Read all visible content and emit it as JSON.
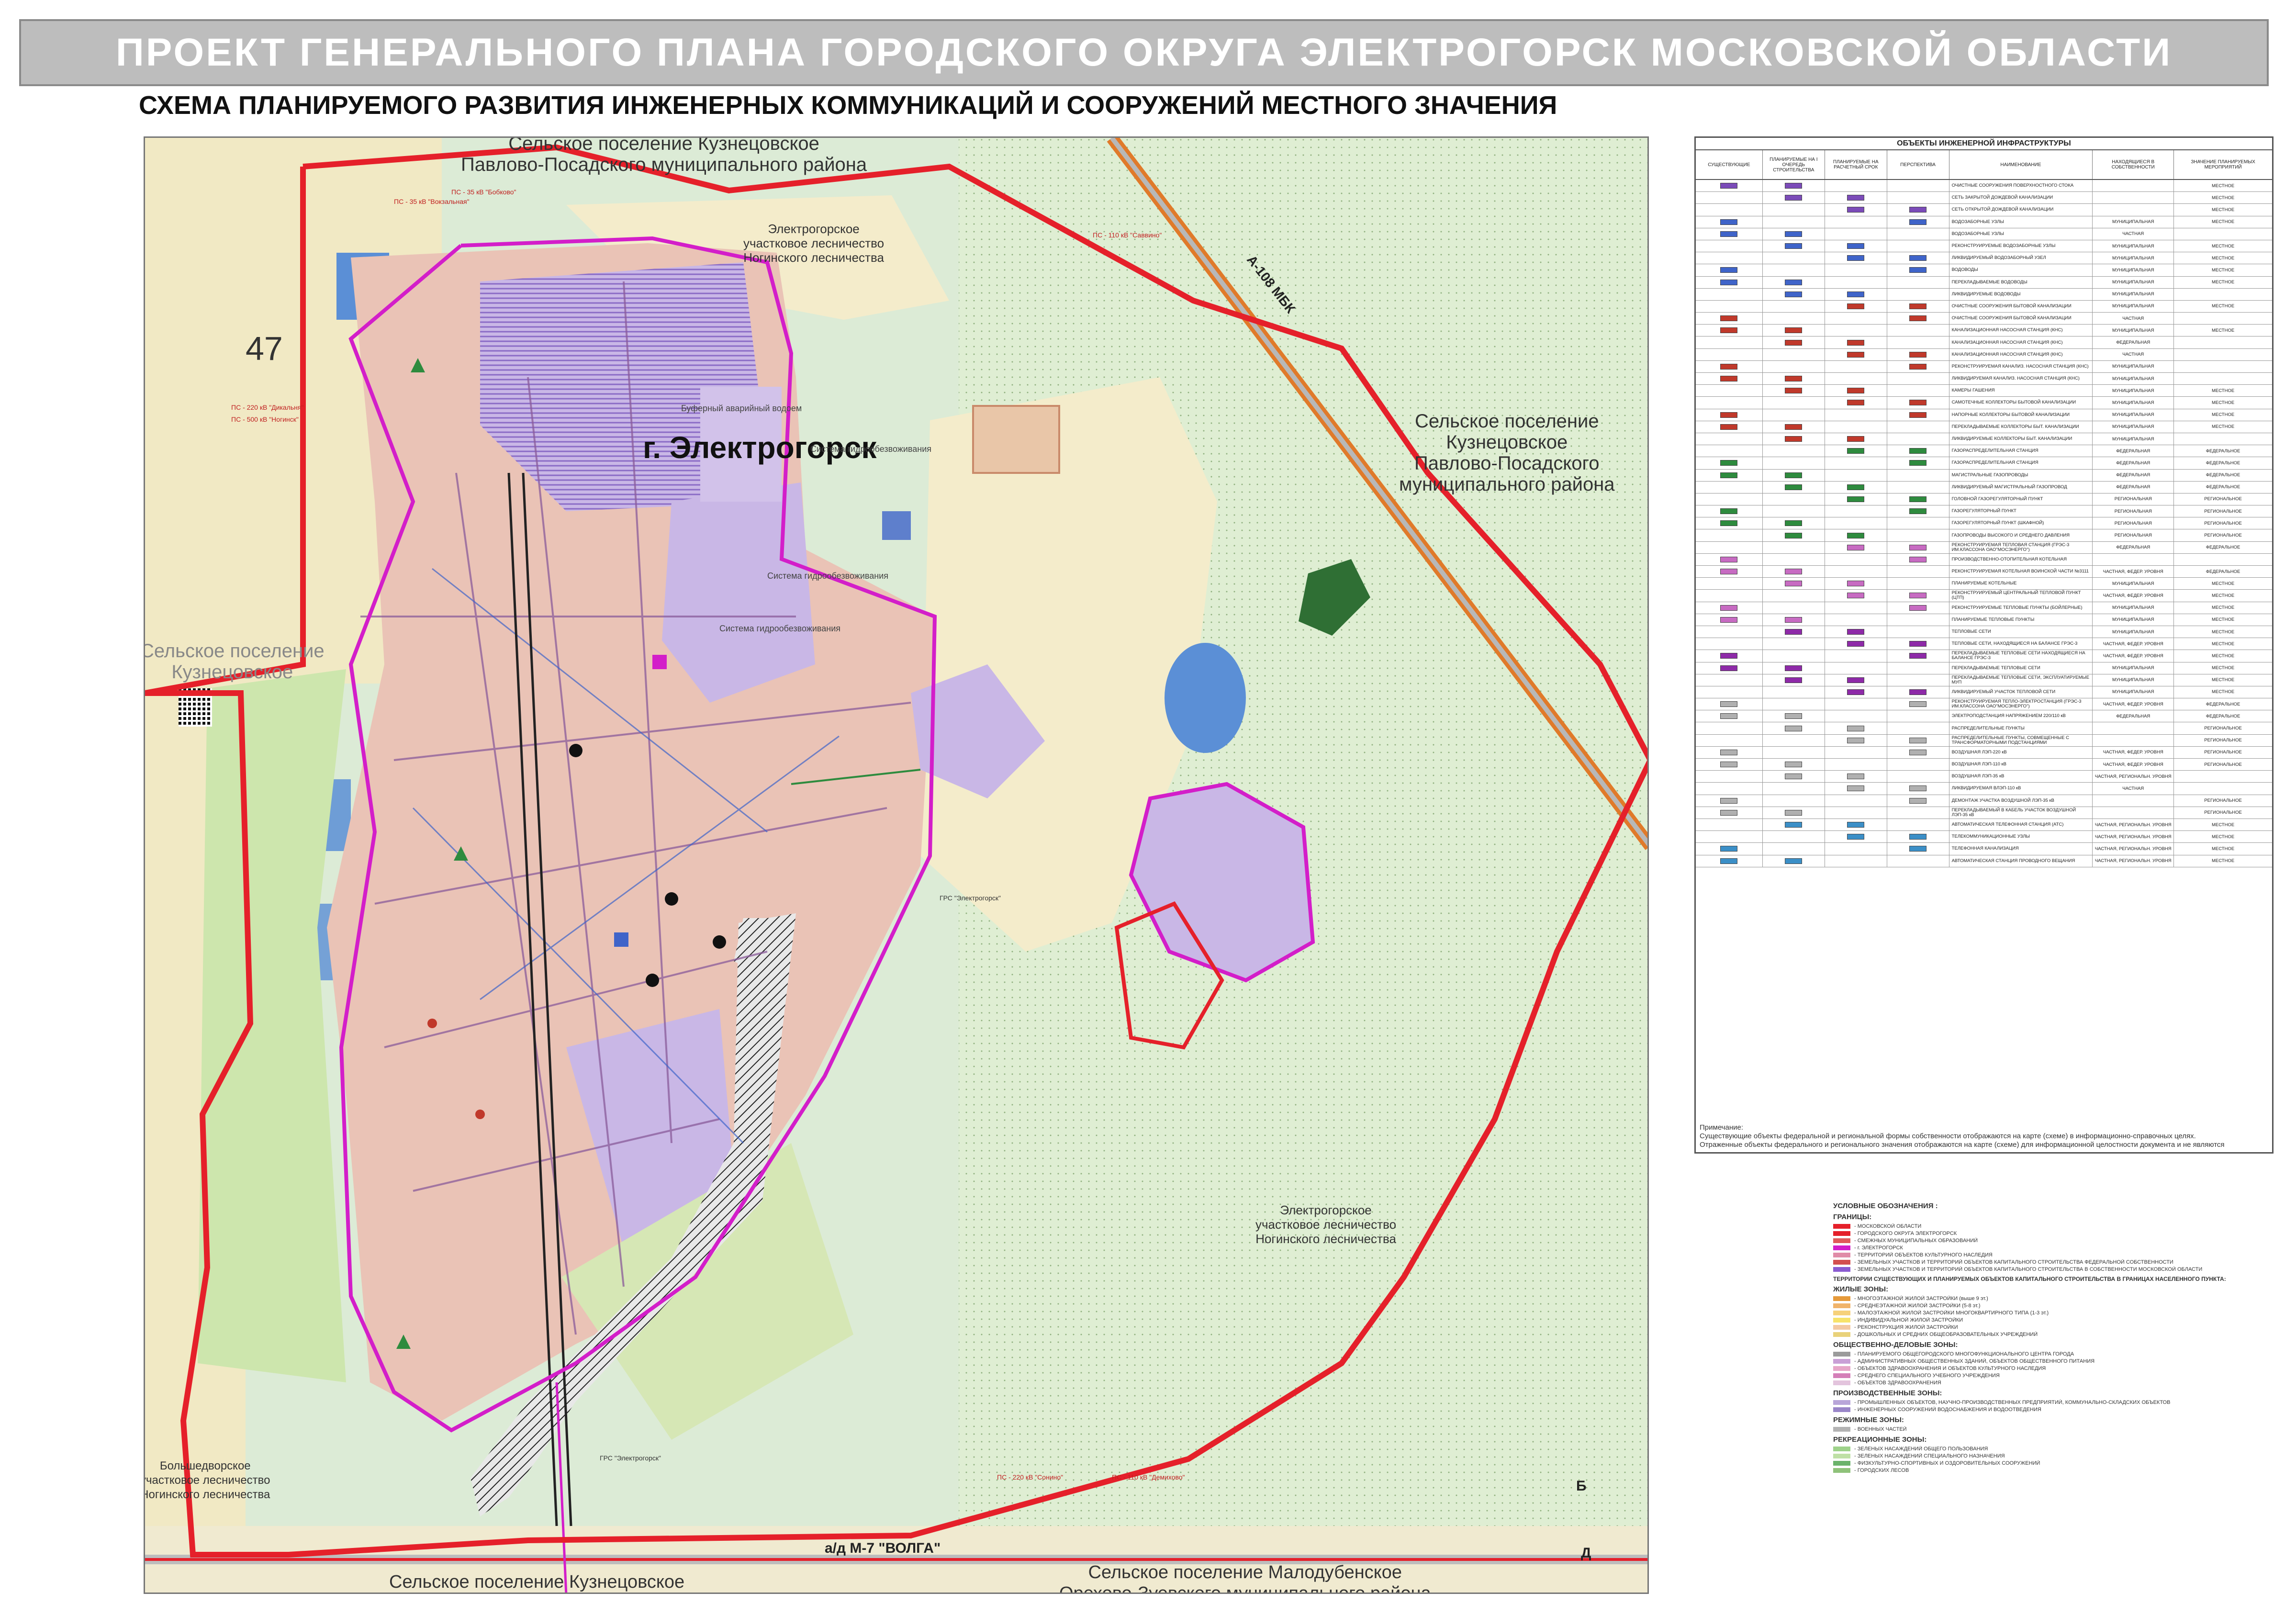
{
  "header": {
    "title": "ПРОЕКТ ГЕНЕРАЛЬНОГО ПЛАНА ГОРОДСКОГО ОКРУГА ЭЛЕКТРОГОРСК МОСКОВСКОЙ ОБЛАСТИ",
    "subtitle": "СХЕМА ПЛАНИРУЕМОГО РАЗВИТИЯ ИНЖЕНЕРНЫХ КОММУНИКАЦИЙ И СООРУЖЕНИЙ МЕСТНОГО ЗНАЧЕНИЯ"
  },
  "colors": {
    "boundary": "#e5202a",
    "city_boundary": "#d31ec9",
    "forest": "#cfe3c6",
    "field": "#f3ecc9",
    "residential": "#f2c2a8",
    "industrial": "#c9b7e6",
    "water": "#5b8fd6",
    "road": "#9a9a9a"
  },
  "map": {
    "labels": {
      "north_top": "Сельское поселение Кузнецовское",
      "north_top2": "Павлово-Посадского муниципального района",
      "forest_north_1": "Электрогорское",
      "forest_north_2": "участковое лесничество",
      "forest_north_3": "Ногинского лесничества",
      "city": "г. Электрогорск",
      "east_1": "Сельское поселение",
      "east_2": "Кузнецовское",
      "east_3": "Павлово-Посадского",
      "east_4": "муниципального района",
      "west_1": "Сельское поселение",
      "west_2": "Кузнецовское",
      "forest_se_1": "Электрогорское",
      "forest_se_2": "участковое лесничество",
      "forest_se_3": "Ногинского лесничества",
      "forest_sw_1": "Большедворское",
      "forest_sw_2": "участковое лесничество",
      "forest_sw_3": "Ногинского лесничества",
      "south_left": "Сельское поселение Кузнецовское",
      "south_right_1": "Сельское поселение Малодубенское",
      "south_right_2": "Орехово-Зуевского муниципального района",
      "road_m7": "а/д М-7 \"ВОЛГА\"",
      "road_a108": "А-108 МБК",
      "quarter": "47",
      "water_reservoir": "Буферный аварийный водоем",
      "sys1": "Система гидрообезвоживания",
      "sys2": "Система гидрообезвоживания",
      "sys3": "Система гидрообезвоживания",
      "ps_35": "ПС - 35 кВ \"Вокзальная\"",
      "ps_35b": "ПС - 35 кВ \"Бобково\"",
      "ps_110": "ПС - 110 кВ \"Саввино\"",
      "ps_220": "ПС - 220 кВ \"Дикальня\"",
      "ps_220b": "ПС - 500 кВ \"Ногинск\"",
      "grs": "ГРС \"Электрогорск\"",
      "grs2": "ГРС \"Электрогорск\"",
      "ps_220_south": "ПС - 220 кВ \"Сонино\"",
      "ps_110_south": "ПС - 110 кВ \"Демихово\"",
      "mark_b": "Б",
      "mark_d": "Д"
    }
  },
  "legend": {
    "title": "ОБЪЕКТЫ ИНЖЕНЕРНОЙ ИНФРАСТРУКТУРЫ",
    "columns": [
      "СУЩЕСТВУЮЩИЕ",
      "ПЛАНИРУЕМЫЕ НА I ОЧЕРЕДЬ СТРОИТЕЛЬСТВА",
      "ПЛАНИРУЕМЫЕ НА РАСЧЕТНЫЙ СРОК",
      "ПЕРСПЕКТИВА",
      "НАИМЕНОВАНИЕ",
      "НАХОДЯЩИЕСЯ В СОБСТВЕННОСТИ",
      "ЗНАЧЕНИЕ ПЛАНИРУЕМЫХ МЕРОПРИЯТИЙ"
    ],
    "rows": [
      {
        "name": "ОЧИСТНЫЕ СООРУЖЕНИЯ ПОВЕРХНОСТНОГО СТОКА",
        "own": "",
        "sig": "МЕСТНОЕ",
        "color": "#7b4bb8"
      },
      {
        "name": "СЕТЬ ЗАКРЫТОЙ ДОЖДЕВОЙ КАНАЛИЗАЦИИ",
        "own": "",
        "sig": "МЕСТНОЕ",
        "color": "#7b4bb8"
      },
      {
        "name": "СЕТЬ ОТКРЫТОЙ ДОЖДЕВОЙ КАНАЛИЗАЦИИ",
        "own": "",
        "sig": "МЕСТНОЕ",
        "color": "#7b4bb8"
      },
      {
        "name": "ВОДОЗАБОРНЫЕ УЗЛЫ",
        "own": "МУНИЦИПАЛЬНАЯ",
        "sig": "МЕСТНОЕ",
        "color": "#3f64c9"
      },
      {
        "name": "ВОДОЗАБОРНЫЕ УЗЛЫ",
        "own": "ЧАСТНАЯ",
        "sig": "",
        "color": "#3f64c9"
      },
      {
        "name": "РЕКОНСТРУИРУЕМЫЕ ВОДОЗАБОРНЫЕ УЗЛЫ",
        "own": "МУНИЦИПАЛЬНАЯ",
        "sig": "МЕСТНОЕ",
        "color": "#3f64c9"
      },
      {
        "name": "ЛИКВИДИРУЕМЫЙ ВОДОЗАБОРНЫЙ УЗЕЛ",
        "own": "МУНИЦИПАЛЬНАЯ",
        "sig": "МЕСТНОЕ",
        "color": "#3f64c9"
      },
      {
        "name": "ВОДОВОДЫ",
        "own": "МУНИЦИПАЛЬНАЯ",
        "sig": "МЕСТНОЕ",
        "color": "#3f64c9"
      },
      {
        "name": "ПЕРЕКЛАДЫВАЕМЫЕ ВОДОВОДЫ",
        "own": "МУНИЦИПАЛЬНАЯ",
        "sig": "МЕСТНОЕ",
        "color": "#3f64c9"
      },
      {
        "name": "ЛИКВИДИРУЕМЫЕ ВОДОВОДЫ",
        "own": "МУНИЦИПАЛЬНАЯ",
        "sig": "",
        "color": "#3f64c9"
      },
      {
        "name": "ОЧИСТНЫЕ СООРУЖЕНИЯ БЫТОВОЙ КАНАЛИЗАЦИИ",
        "own": "МУНИЦИПАЛЬНАЯ",
        "sig": "МЕСТНОЕ",
        "color": "#c0392b"
      },
      {
        "name": "ОЧИСТНЫЕ СООРУЖЕНИЯ БЫТОВОЙ КАНАЛИЗАЦИИ",
        "own": "ЧАСТНАЯ",
        "sig": "",
        "color": "#c0392b"
      },
      {
        "name": "КАНАЛИЗАЦИОННАЯ НАСОСНАЯ СТАНЦИЯ (КНС)",
        "own": "МУНИЦИПАЛЬНАЯ",
        "sig": "МЕСТНОЕ",
        "color": "#c0392b"
      },
      {
        "name": "КАНАЛИЗАЦИОННАЯ НАСОСНАЯ СТАНЦИЯ (КНС)",
        "own": "ФЕДЕРАЛЬНАЯ",
        "sig": "",
        "color": "#c0392b"
      },
      {
        "name": "КАНАЛИЗАЦИОННАЯ НАСОСНАЯ СТАНЦИЯ (КНС)",
        "own": "ЧАСТНАЯ",
        "sig": "",
        "color": "#c0392b"
      },
      {
        "name": "РЕКОНСТРУИРУЕМАЯ КАНАЛИЗ. НАСОСНАЯ СТАНЦИЯ (КНС)",
        "own": "МУНИЦИПАЛЬНАЯ",
        "sig": "",
        "color": "#c0392b"
      },
      {
        "name": "ЛИКВИДИРУЕМАЯ КАНАЛИЗ. НАСОСНАЯ СТАНЦИЯ (КНС)",
        "own": "МУНИЦИПАЛЬНАЯ",
        "sig": "",
        "color": "#c0392b"
      },
      {
        "name": "КАМЕРЫ ГАШЕНИЯ",
        "own": "МУНИЦИПАЛЬНАЯ",
        "sig": "МЕСТНОЕ",
        "color": "#c0392b"
      },
      {
        "name": "САМОТЕЧНЫЕ КОЛЛЕКТОРЫ БЫТОВОЙ КАНАЛИЗАЦИИ",
        "own": "МУНИЦИПАЛЬНАЯ",
        "sig": "МЕСТНОЕ",
        "color": "#c0392b"
      },
      {
        "name": "НАПОРНЫЕ КОЛЛЕКТОРЫ БЫТОВОЙ КАНАЛИЗАЦИИ",
        "own": "МУНИЦИПАЛЬНАЯ",
        "sig": "МЕСТНОЕ",
        "color": "#c0392b"
      },
      {
        "name": "ПЕРЕКЛАДЫВАЕМЫЕ КОЛЛЕКТОРЫ БЫТ. КАНАЛИЗАЦИИ",
        "own": "МУНИЦИПАЛЬНАЯ",
        "sig": "МЕСТНОЕ",
        "color": "#c0392b"
      },
      {
        "name": "ЛИКВИДИРУЕМЫЕ КОЛЛЕКТОРЫ БЫТ. КАНАЛИЗАЦИИ",
        "own": "МУНИЦИПАЛЬНАЯ",
        "sig": "",
        "color": "#c0392b"
      },
      {
        "name": "ГАЗОРАСПРЕДЕЛИТЕЛЬНАЯ СТАНЦИЯ",
        "own": "ФЕДЕРАЛЬНАЯ",
        "sig": "ФЕДЕРАЛЬНОЕ",
        "color": "#2e8b3e"
      },
      {
        "name": "ГАЗОРАСПРЕДЕЛИТЕЛЬНАЯ СТАНЦИЯ",
        "own": "ФЕДЕРАЛЬНАЯ",
        "sig": "ФЕДЕРАЛЬНОЕ",
        "color": "#2e8b3e"
      },
      {
        "name": "МАГИСТРАЛЬНЫЕ ГАЗОПРОВОДЫ",
        "own": "ФЕДЕРАЛЬНАЯ",
        "sig": "ФЕДЕРАЛЬНОЕ",
        "color": "#2e8b3e"
      },
      {
        "name": "ЛИКВИДИРУЕМЫЙ МАГИСТРАЛЬНЫЙ ГАЗОПРОВОД",
        "own": "ФЕДЕРАЛЬНАЯ",
        "sig": "ФЕДЕРАЛЬНОЕ",
        "color": "#2e8b3e"
      },
      {
        "name": "ГОЛОВНОЙ ГАЗОРЕГУЛЯТОРНЫЙ ПУНКТ",
        "own": "РЕГИОНАЛЬНАЯ",
        "sig": "РЕГИОНАЛЬНОЕ",
        "color": "#2e8b3e"
      },
      {
        "name": "ГАЗОРЕГУЛЯТОРНЫЙ ПУНКТ",
        "own": "РЕГИОНАЛЬНАЯ",
        "sig": "РЕГИОНАЛЬНОЕ",
        "color": "#2e8b3e"
      },
      {
        "name": "ГАЗОРЕГУЛЯТОРНЫЙ ПУНКТ (ШКАФНОЙ)",
        "own": "РЕГИОНАЛЬНАЯ",
        "sig": "РЕГИОНАЛЬНОЕ",
        "color": "#2e8b3e"
      },
      {
        "name": "ГАЗОПРОВОДЫ ВЫСОКОГО И СРЕДНЕГО ДАВЛЕНИЯ",
        "own": "РЕГИОНАЛЬНАЯ",
        "sig": "РЕГИОНАЛЬНОЕ",
        "color": "#2e8b3e"
      },
      {
        "name": "РЕКОНСТРУИРУЕМАЯ ТЕПЛОВАЯ СТАНЦИЯ (ГРЭС-3 ИМ.КЛАССОНА ОАО\"МОСЭНЕРГО\")",
        "own": "ФЕДЕРАЛЬНАЯ",
        "sig": "ФЕДЕРАЛЬНОЕ",
        "color": "#c76bc2"
      },
      {
        "name": "ПРОИЗВОДСТВЕННО-ОТОПИТЕЛЬНАЯ КОТЕЛЬНАЯ",
        "own": "",
        "sig": "",
        "color": "#c76bc2"
      },
      {
        "name": "РЕКОНСТРУИРУЕМАЯ КОТЕЛЬНАЯ ВОИНСКОЙ ЧАСТИ №3111",
        "own": "ЧАСТНАЯ, ФЕДЕР. УРОВНЯ",
        "sig": "ФЕДЕРАЛЬНОЕ",
        "color": "#c76bc2"
      },
      {
        "name": "ПЛАНИРУЕМЫЕ КОТЕЛЬНЫЕ",
        "own": "МУНИЦИПАЛЬНАЯ",
        "sig": "МЕСТНОЕ",
        "color": "#c76bc2"
      },
      {
        "name": "РЕКОНСТРУИРУЕМЫЙ ЦЕНТРАЛЬНЫЙ ТЕПЛОВОЙ ПУНКТ (ЦТП)",
        "own": "ЧАСТНАЯ, ФЕДЕР. УРОВНЯ",
        "sig": "МЕСТНОЕ",
        "color": "#c76bc2"
      },
      {
        "name": "РЕКОНСТРУИРУЕМЫЕ ТЕПЛОВЫЕ ПУНКТЫ (БОЙЛЕРНЫЕ)",
        "own": "МУНИЦИПАЛЬНАЯ",
        "sig": "МЕСТНОЕ",
        "color": "#c76bc2"
      },
      {
        "name": "ПЛАНИРУЕМЫЕ ТЕПЛОВЫЕ ПУНКТЫ",
        "own": "МУНИЦИПАЛЬНАЯ",
        "sig": "МЕСТНОЕ",
        "color": "#c76bc2"
      },
      {
        "name": "ТЕПЛОВЫЕ СЕТИ",
        "own": "МУНИЦИПАЛЬНАЯ",
        "sig": "МЕСТНОЕ",
        "color": "#8e2aa8"
      },
      {
        "name": "ТЕПЛОВЫЕ СЕТИ, НАХОДЯЩИЕСЯ НА БАЛАНСЕ ГРЭС-3",
        "own": "ЧАСТНАЯ, ФЕДЕР. УРОВНЯ",
        "sig": "МЕСТНОЕ",
        "color": "#8e2aa8"
      },
      {
        "name": "ПЕРЕКЛАДЫВАЕМЫЕ ТЕПЛОВЫЕ СЕТИ НАХОДЯЩИЕСЯ НА БАЛАНСЕ ГРЭС-3",
        "own": "ЧАСТНАЯ, ФЕДЕР. УРОВНЯ",
        "sig": "МЕСТНОЕ",
        "color": "#8e2aa8"
      },
      {
        "name": "ПЕРЕКЛАДЫВАЕМЫЕ ТЕПЛОВЫЕ СЕТИ",
        "own": "МУНИЦИПАЛЬНАЯ",
        "sig": "МЕСТНОЕ",
        "color": "#8e2aa8"
      },
      {
        "name": "ПЕРЕКЛАДЫВАЕМЫЕ ТЕПЛОВЫЕ СЕТИ, ЭКСПЛУАТИРУЕМЫЕ МУП",
        "own": "МУНИЦИПАЛЬНАЯ",
        "sig": "МЕСТНОЕ",
        "color": "#8e2aa8"
      },
      {
        "name": "ЛИКВИДИРУЕМЫЙ УЧАСТОК ТЕПЛОВОЙ СЕТИ",
        "own": "МУНИЦИПАЛЬНАЯ",
        "sig": "МЕСТНОЕ",
        "color": "#8e2aa8"
      },
      {
        "name": "РЕКОНСТРУИРУЕМАЯ ТЕПЛО-ЭЛЕКТРОСТАНЦИЯ (ГРЭС-3 ИМ.КЛАССОНА ОАО\"МОСЭНЕРГО\")",
        "own": "ЧАСТНАЯ, ФЕДЕР. УРОВНЯ",
        "sig": "ФЕДЕРАЛЬНОЕ",
        "color": "#b0b0b0"
      },
      {
        "name": "ЭЛЕКТРОПОДСТАНЦИЯ НАПРЯЖЕНИЕМ 220/110 кВ",
        "own": "ФЕДЕРАЛЬНАЯ",
        "sig": "ФЕДЕРАЛЬНОЕ",
        "color": "#b0b0b0"
      },
      {
        "name": "РАСПРЕДЕЛИТЕЛЬНЫЕ ПУНКТЫ",
        "own": "",
        "sig": "РЕГИОНАЛЬНОЕ",
        "color": "#b0b0b0"
      },
      {
        "name": "РАСПРЕДЕЛИТЕЛЬНЫЕ ПУНКТЫ, СОВМЕЩЕННЫЕ С ТРАНСФОРМАТОРНЫМИ ПОДСТАНЦИЯМИ",
        "own": "",
        "sig": "РЕГИОНАЛЬНОЕ",
        "color": "#b0b0b0"
      },
      {
        "name": "ВОЗДУШНАЯ ЛЭП-220 кВ",
        "own": "ЧАСТНАЯ, ФЕДЕР. УРОВНЯ",
        "sig": "РЕГИОНАЛЬНОЕ",
        "color": "#b0b0b0"
      },
      {
        "name": "ВОЗДУШНАЯ ЛЭП-110 кВ",
        "own": "ЧАСТНАЯ, ФЕДЕР. УРОВНЯ",
        "sig": "РЕГИОНАЛЬНОЕ",
        "color": "#b0b0b0"
      },
      {
        "name": "ВОЗДУШНАЯ ЛЭП-35 кВ",
        "own": "ЧАСТНАЯ, РЕГИОНАЛЬН. УРОВНЯ",
        "sig": "",
        "color": "#b0b0b0"
      },
      {
        "name": "ЛИКВИДИРУЕМАЯ ВЛЭП-110 кВ",
        "own": "ЧАСТНАЯ",
        "sig": "",
        "color": "#b0b0b0"
      },
      {
        "name": "ДЕМОНТАЖ УЧАСТКА ВОЗДУШНОЙ ЛЭП-35 кВ",
        "own": "",
        "sig": "РЕГИОНАЛЬНОЕ",
        "color": "#b0b0b0"
      },
      {
        "name": "ПЕРЕКЛАДЫВАЕМЫЙ В КАБЕЛЬ УЧАСТОК ВОЗДУШНОЙ ЛЭП-35 кВ",
        "own": "",
        "sig": "РЕГИОНАЛЬНОЕ",
        "color": "#b0b0b0"
      },
      {
        "name": "АВТОМАТИЧЕСКАЯ ТЕЛЕФОННАЯ СТАНЦИЯ (АТС)",
        "own": "ЧАСТНАЯ, РЕГИОНАЛЬН. УРОВНЯ",
        "sig": "МЕСТНОЕ",
        "color": "#3b8fc7"
      },
      {
        "name": "ТЕЛЕКОММУНИКАЦИОННЫЕ УЗЛЫ",
        "own": "ЧАСТНАЯ, РЕГИОНАЛЬН. УРОВНЯ",
        "sig": "МЕСТНОЕ",
        "color": "#3b8fc7"
      },
      {
        "name": "ТЕЛЕФОННАЯ КАНАЛИЗАЦИЯ",
        "own": "ЧАСТНАЯ, РЕГИОНАЛЬН. УРОВНЯ",
        "sig": "МЕСТНОЕ",
        "color": "#3b8fc7"
      },
      {
        "name": "АВТОМАТИЧЕСКАЯ СТАНЦИЯ ПРОВОДНОГО ВЕЩАНИЯ",
        "own": "ЧАСТНАЯ, РЕГИОНАЛЬН. УРОВНЯ",
        "sig": "МЕСТНОЕ",
        "color": "#3b8fc7"
      }
    ],
    "note_title": "Примечание:",
    "note_1": "Существующие объекты федеральной и региональной формы собственности отображаются на карте (схеме) в информационно-справочных целях.",
    "note_2": "Отраженные объекты федерального и регионального значения отображаются на карте (схеме) для информационной целостности документа и не являются"
  },
  "conventions": {
    "title": "УСЛОВНЫЕ ОБОЗНАЧЕНИЯ :",
    "group_borders": "ГРАНИЦЫ:",
    "borders": [
      {
        "text": "- МОСКОВСКОЙ ОБЛАСТИ",
        "color": "#e5202a"
      },
      {
        "text": "- ГОРОДСКОГО ОКРУГА ЭЛЕКТРОГОРСК",
        "color": "#e5202a"
      },
      {
        "text": "- СМЕЖНЫХ МУНИЦИПАЛЬНЫХ ОБРАЗОВАНИЙ",
        "color": "#e05a5a"
      },
      {
        "text": "- г. ЭЛЕКТРОГОРСК",
        "color": "#d31ec9"
      },
      {
        "text": "- ТЕРРИТОРИЙ ОБЪЕКТОВ КУЛЬТУРНОГО НАСЛЕДИЯ",
        "color": "#e08ca8"
      },
      {
        "text": "- ЗЕМЕЛЬНЫХ УЧАСТКОВ И ТЕРРИТОРИЙ ОБЪЕКТОВ КАПИТАЛЬНОГО СТРОИТЕЛЬСТВА ФЕДЕРАЛЬНОЙ СОБСТВЕННОСТИ",
        "color": "#d34f4f"
      },
      {
        "text": "- ЗЕМЕЛЬНЫХ УЧАСТКОВ И ТЕРРИТОРИЙ ОБЪЕКТОВ КАПИТАЛЬНОГО СТРОИТЕЛЬСТВА В СОБСТВЕННОСТИ МОСКОВСКОЙ ОБЛАСТИ",
        "color": "#8a5bd1"
      }
    ],
    "group_territories": "ТЕРРИТОРИИ СУЩЕСТВУЮЩИХ И ПЛАНИРУЕМЫХ ОБЪЕКТОВ КАПИТАЛЬНОГО СТРОИТЕЛЬСТВА В ГРАНИЦАХ НАСЕЛЕННОГО ПУНКТА:",
    "group_living": "ЖИЛЫЕ ЗОНЫ:",
    "living": [
      {
        "text": "- МНОГОЭТАЖНОЙ ЖИЛОЙ ЗАСТРОЙКИ (выше 9 эт.)",
        "color": "#e69a3a"
      },
      {
        "text": "- СРЕДНЕЭТАЖНОЙ ЖИЛОЙ ЗАСТРОЙКИ (5-8 эт.)",
        "color": "#f0b36a"
      },
      {
        "text": "- МАЛОЭТАЖНОЙ ЖИЛОЙ ЗАСТРОЙКИ МНОГОКВАРТИРНОГО ТИПА (1-3 эт.)",
        "color": "#f6d17a"
      },
      {
        "text": "- ИНДИВИДУАЛЬНОЙ ЖИЛОЙ ЗАСТРОЙКИ",
        "color": "#f7e36a"
      },
      {
        "text": "- РЕКОНСТРУКЦИЯ ЖИЛОЙ ЗАСТРОЙКИ",
        "color": "#f3c9a2"
      },
      {
        "text": "- ДОШКОЛЬНЫХ И СРЕДНИХ ОБЩЕОБРАЗОВАТЕЛЬНЫХ УЧРЕЖДЕНИЙ",
        "color": "#e9d27a"
      }
    ],
    "group_public": "ОБЩЕСТВЕННО-ДЕЛОВЫЕ ЗОНЫ:",
    "public": [
      {
        "text": "- ПЛАНИРУЕМОГО ОБЩЕГОРОДСКОГО МНОГОФУНКЦИОНАЛЬНОГО ЦЕНТРА ГОРОДА",
        "color": "#9b9b9b"
      },
      {
        "text": "- АДМИНИСТРАТИВНЫХ ОБЩЕСТВЕННЫХ ЗДАНИЙ, ОБЪЕКТОВ ОБЩЕСТВЕННОГО ПИТАНИЯ",
        "color": "#c9a0d6"
      },
      {
        "text": "- ОБЪЕКТОВ ЗДРАВООХРАНЕНИЯ И ОБЪЕКТОВ КУЛЬТУРНОГО НАСЛЕДИЯ",
        "color": "#e7a6c8"
      },
      {
        "text": "- СРЕДНЕГО СПЕЦИАЛЬНОГО УЧЕБНОГО УЧРЕЖДЕНИЯ",
        "color": "#d47fb8"
      },
      {
        "text": "- ОБЪЕКТОВ ЗДРАВООХРАНЕНИЯ",
        "color": "#e3c4dd"
      }
    ],
    "group_industrial": "ПРОИЗВОДСТВЕННЫЕ ЗОНЫ:",
    "industrial": [
      {
        "text": "- ПРОМЫШЛЕННЫХ ОБЪЕКТОВ, НАУЧНО-ПРОИЗВОДСТВЕННЫХ ПРЕДПРИЯТИЙ, КОММУНАЛЬНО-СКЛАДСКИХ ОБЪЕКТОВ",
        "color": "#b9a6d9"
      },
      {
        "text": "- ИНЖЕНЕРНЫХ СООРУЖЕНИЙ ВОДОСНАБЖЕНИЯ И ВОДООТВЕДЕНИЯ",
        "color": "#9a86c9"
      }
    ],
    "group_military": "РЕЖИМНЫЕ ЗОНЫ:",
    "military": [
      {
        "text": "- ВОЕННЫХ ЧАСТЕЙ",
        "color": "#b3b3b3"
      }
    ],
    "group_recreation": "РЕКРЕАЦИОННЫЕ ЗОНЫ:",
    "recreation": [
      {
        "text": "- ЗЕЛЕНЫХ НАСАЖДЕНИЙ ОБЩЕГО ПОЛЬЗОВАНИЯ",
        "color": "#9ed28a"
      },
      {
        "text": "- ЗЕЛЕНЫХ НАСАЖДЕНИЙ СПЕЦИАЛЬНОГО НАЗНАЧЕНИЯ",
        "color": "#bfe0a6"
      },
      {
        "text": "- ФИЗКУЛЬТУРНО-СПОРТИВНЫХ И ОЗДОРОВИТЕЛЬНЫХ СООРУЖЕНИЙ",
        "color": "#6bb36b"
      },
      {
        "text": "- ГОРОДСКИХ ЛЕСОВ",
        "color": "#8fc27a"
      }
    ]
  }
}
